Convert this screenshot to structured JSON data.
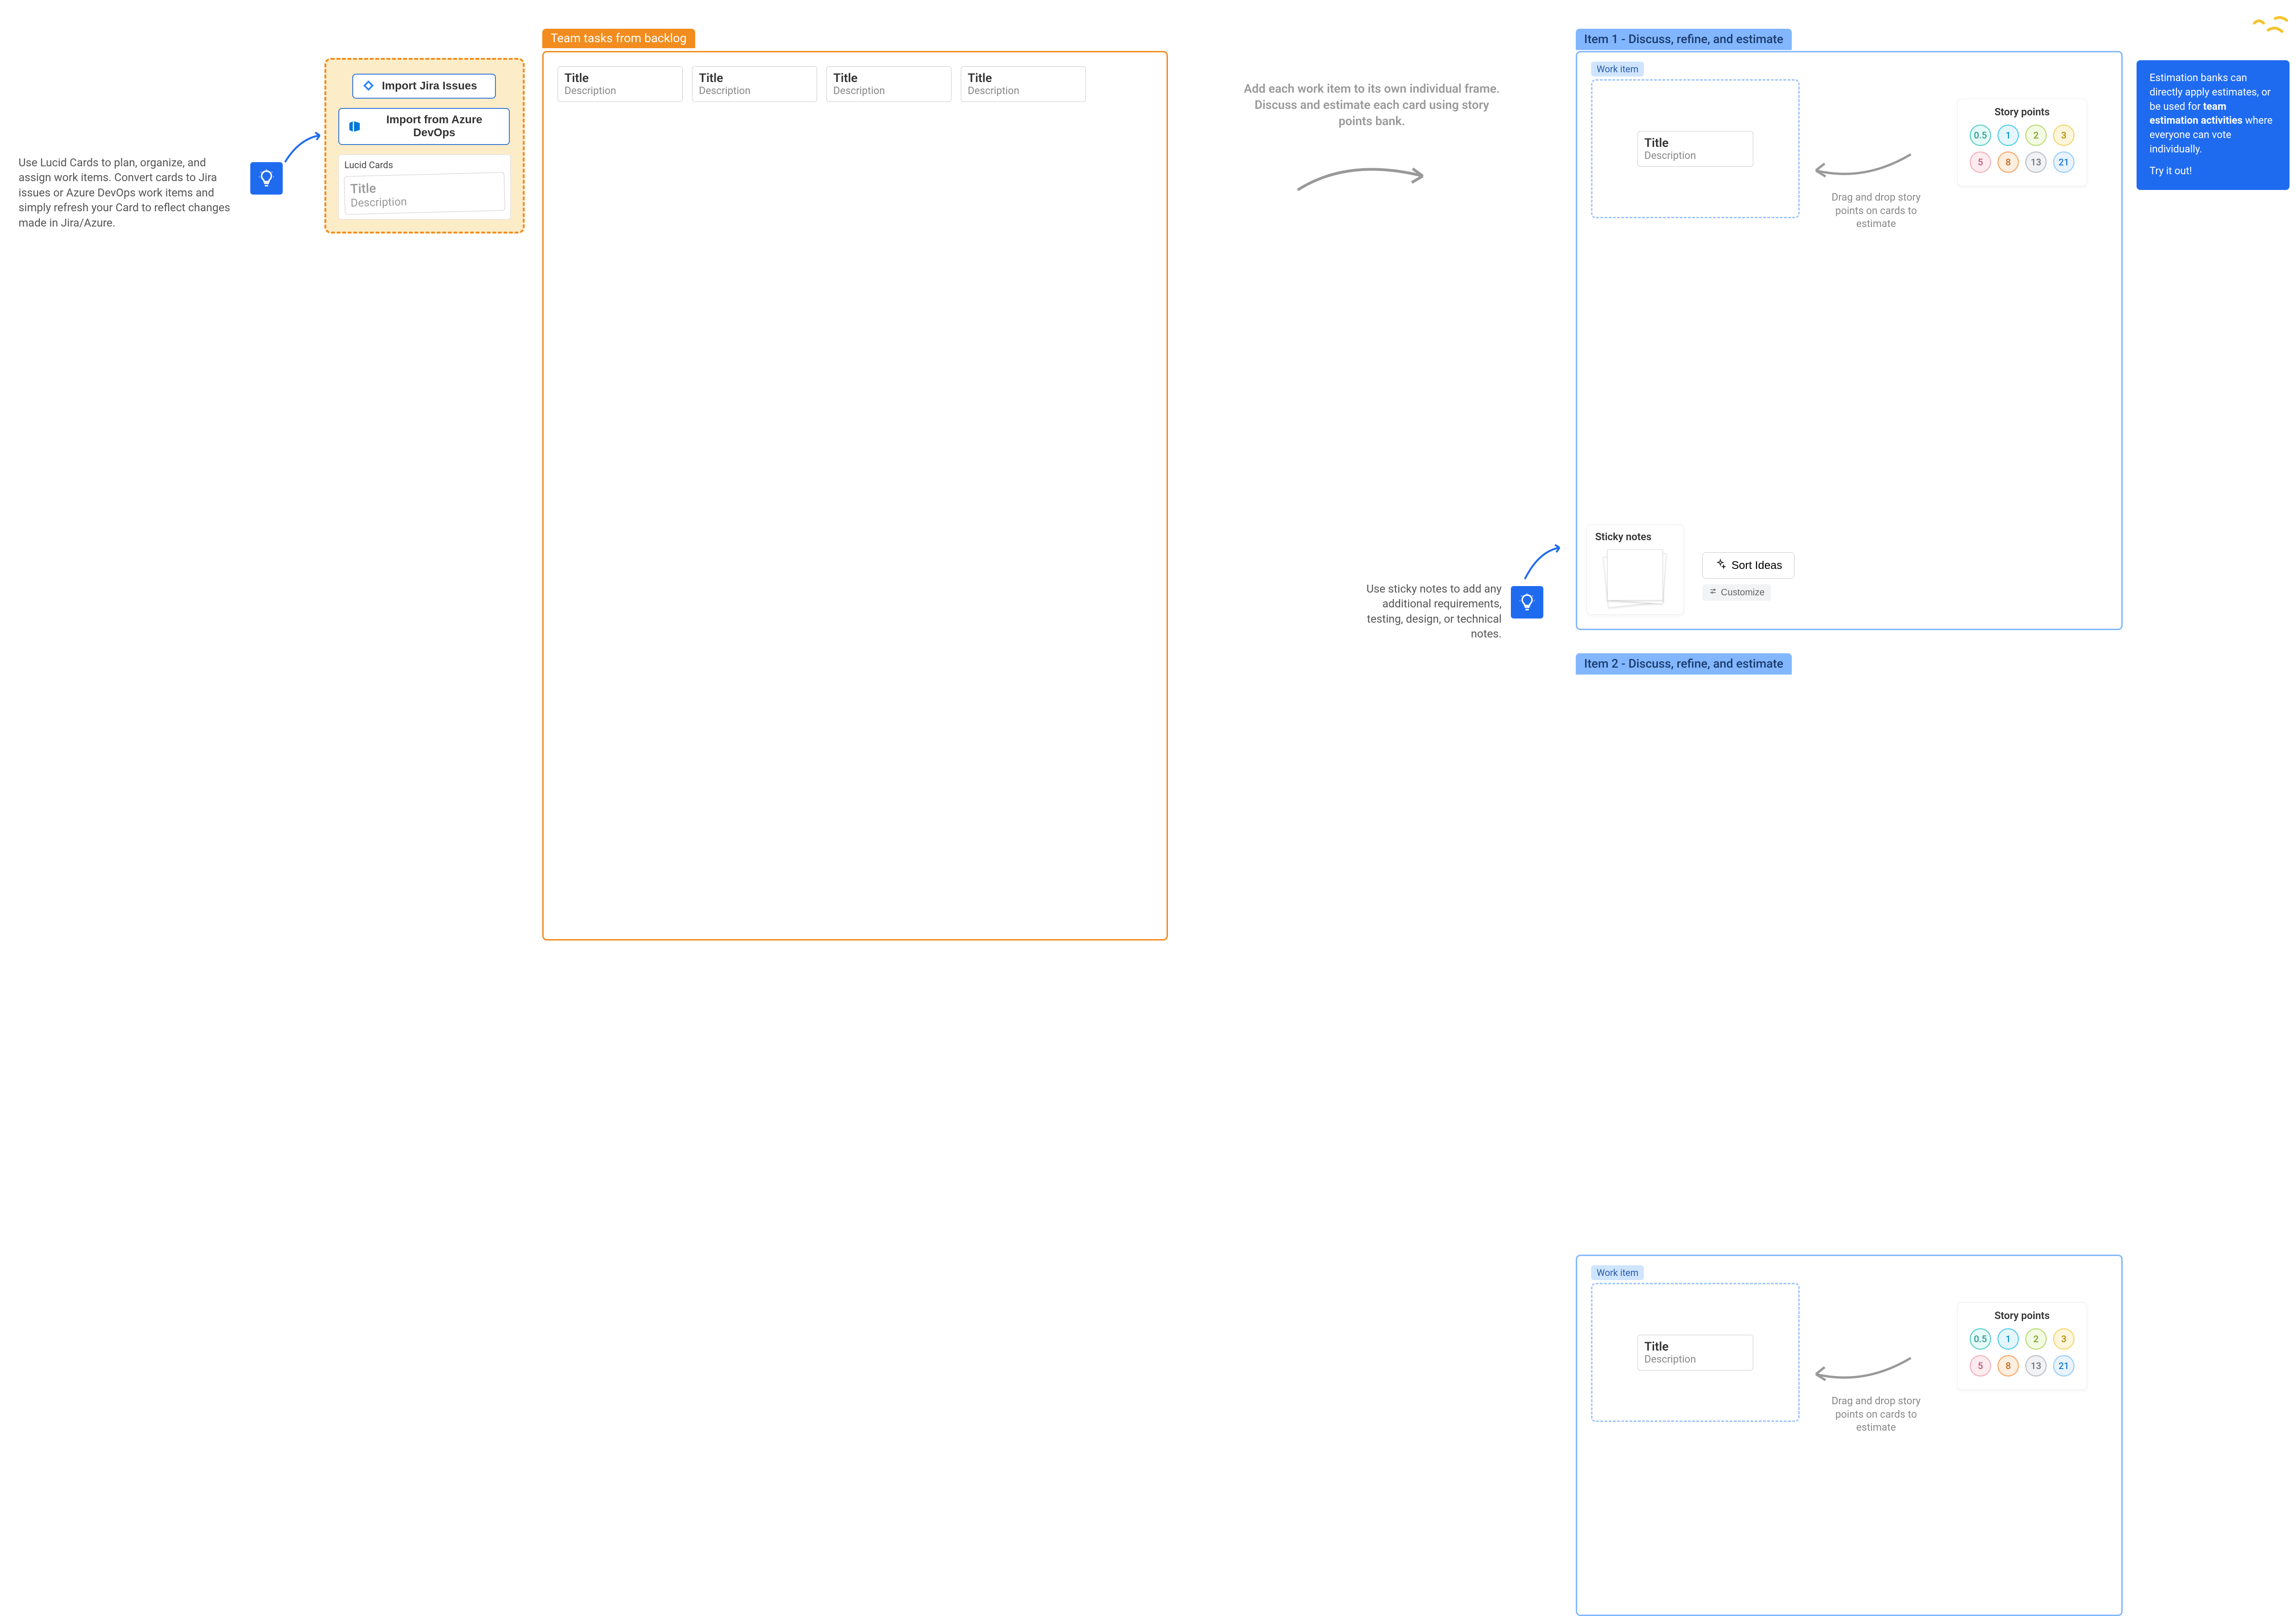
{
  "tips": {
    "lucid_cards": "Use Lucid Cards to plan, organize, and assign work items. Convert cards to Jira issues or Azure DevOps work items and simply refresh your Card to reflect changes made in Jira/Azure.",
    "center": "Add each work item to its own individual frame. Discuss and estimate each card using story points bank.",
    "sticky": "Use sticky notes to add any additional requirements, testing, design, or technical notes."
  },
  "import_panel": {
    "jira_label": "Import Jira Issues",
    "azure_label": "Import from Azure DevOps",
    "lucid_label": "Lucid Cards",
    "card_title": "Title",
    "card_desc": "Description"
  },
  "backlog": {
    "tab": "Team tasks from backlog",
    "cards": [
      {
        "title": "Title",
        "desc": "Description"
      },
      {
        "title": "Title",
        "desc": "Description"
      },
      {
        "title": "Title",
        "desc": "Description"
      },
      {
        "title": "Title",
        "desc": "Description"
      }
    ]
  },
  "items": [
    {
      "tab": "Item 1 - Discuss, refine, and estimate",
      "wi_label": "Work item",
      "wi_title": "Title",
      "wi_desc": "Description",
      "drag_help": "Drag and drop story points on cards to estimate"
    },
    {
      "tab": "Item 2 - Discuss, refine, and estimate",
      "wi_label": "Work item",
      "wi_title": "Title",
      "wi_desc": "Description",
      "drag_help": "Drag and drop story points on cards to estimate"
    }
  ],
  "story_points": {
    "title": "Story points",
    "row1": [
      "0.5",
      "1",
      "2",
      "3"
    ],
    "row2": [
      "5",
      "8",
      "13",
      "21"
    ],
    "colors_row1": [
      "c-teal",
      "c-cyan",
      "c-lime",
      "c-yellow"
    ],
    "colors_row2": [
      "c-pink",
      "c-orange",
      "c-gray",
      "c-blue"
    ]
  },
  "sticky": {
    "title": "Sticky notes",
    "sort_label": "Sort Ideas",
    "customize_label": "Customize"
  },
  "callout": {
    "line1": "Estimation banks can directly apply estimates, or be used for ",
    "bold": "team estimation activities",
    "line2": " where everyone can vote individually.",
    "try": "Try it out!"
  }
}
